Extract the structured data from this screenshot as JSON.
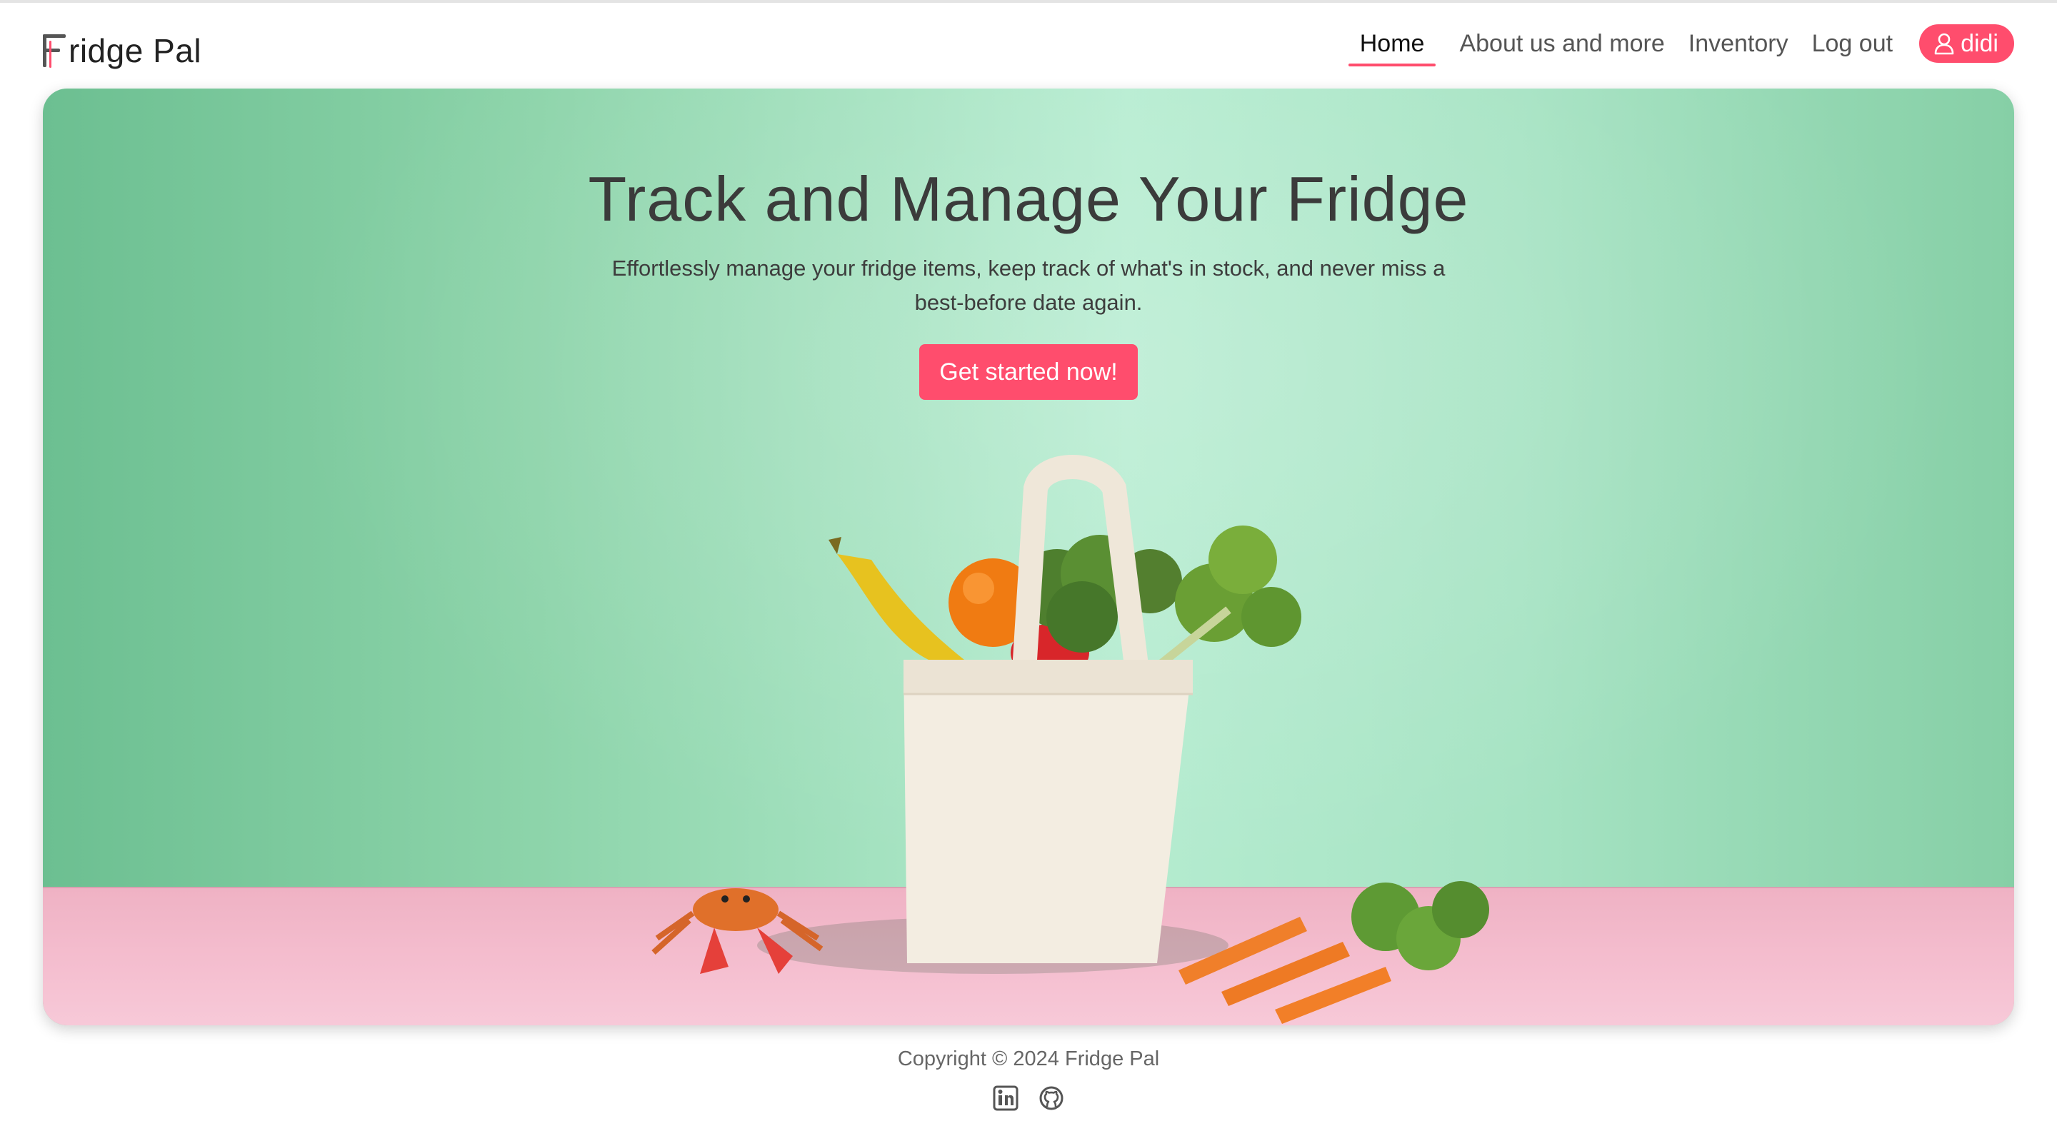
{
  "brand": {
    "name": "ridge Pal",
    "logo_letter": "F"
  },
  "nav": {
    "items": [
      {
        "label": "Home",
        "active": true
      },
      {
        "label": "About us and more",
        "active": false
      },
      {
        "label": "Inventory",
        "active": false
      },
      {
        "label": "Log out",
        "active": false
      }
    ],
    "user": {
      "name": "didi",
      "icon": "user-icon"
    }
  },
  "hero": {
    "title": "Track and Manage Your Fridge",
    "subtitle": "Effortlessly manage your fridge items, keep track of what's in stock, and never miss a best-before date again.",
    "cta_label": "Get started now!"
  },
  "footer": {
    "copyright": "Copyright © 2024 Fridge Pal",
    "social": [
      {
        "name": "linkedin-icon"
      },
      {
        "name": "github-icon"
      }
    ]
  },
  "colors": {
    "accent": "#ff4d6d",
    "hero_wall": "#a6e3c3",
    "hero_floor": "#f5bfd0",
    "text_dark": "#3b3b3b"
  }
}
